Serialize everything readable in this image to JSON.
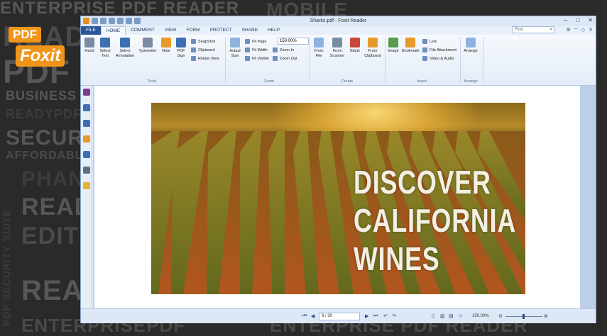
{
  "background_words": [
    "ENTERPRISE PDF READER",
    "MOBILE",
    "READ",
    "PDF",
    "BUSINESS",
    "READYPDF",
    "SECURE",
    "AFFORDABLE",
    "PHAN",
    "READ",
    "EDIT",
    "PDF SECURITY SUITE",
    "READ",
    "ENTERPRISEPDF",
    "ENTERPRISE PDF READER"
  ],
  "logo": {
    "tag": "PDF",
    "brand": "Foxit"
  },
  "window": {
    "title": "Sharks.pdf - Foxit Reader"
  },
  "menu": {
    "tabs": [
      "FILE",
      "HOME",
      "COMMENT",
      "VIEW",
      "FORM",
      "PROTECT",
      "SHARE",
      "HELP"
    ],
    "active": "HOME",
    "find_placeholder": "Find"
  },
  "ribbon": {
    "tools": {
      "hand": "Hand",
      "select_text": "Select Text",
      "select_annotation": "Select Annotation",
      "typewriter": "Typewriter",
      "note": "Note",
      "pdf_sign": "PDF Sign",
      "snapshot": "SnapShot",
      "clipboard": "Clipboard",
      "rotate_view": "Rotate View",
      "label": "Tools"
    },
    "zoom": {
      "actual_size": "Actual Size",
      "fit_page": "Fit Page",
      "fit_width": "Fit Width",
      "fit_visible": "Fit Visible",
      "zoom_value": "150.00%",
      "zoom_in": "Zoom In",
      "zoom_out": "Zoom Out",
      "label": "Zoom"
    },
    "create": {
      "from_file": "From File",
      "from_scanner": "From Scanner",
      "blank": "Blank",
      "from_clipboard": "From Clipboard",
      "label": "Create"
    },
    "insert": {
      "image": "Image",
      "bookmark": "Bookmark",
      "link": "Link",
      "file_attachment": "File Attachment",
      "video_audio": "Video & Audio",
      "label": "Insert"
    },
    "arrange": {
      "arrange": "Arrange",
      "label": "Arrange"
    }
  },
  "document": {
    "headline_lines": [
      "DISCOVER",
      "CALIFORNIA",
      "WINES"
    ]
  },
  "statusbar": {
    "page_indicator": "9 / 20",
    "zoom": "150.00%"
  },
  "colors": {
    "accent": "#2b579a",
    "brand_orange": "#f0951a",
    "background": "#2a2a2a"
  }
}
